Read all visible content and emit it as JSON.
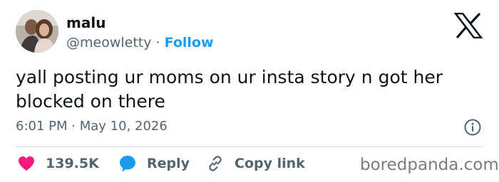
{
  "author": {
    "display_name": "malu",
    "handle": "@meowletty",
    "separator": "·",
    "follow_label": "Follow"
  },
  "tweet": {
    "text": "yall posting ur moms on ur insta story n got her blocked on there",
    "time": "6:01 PM",
    "date_separator": "·",
    "date": "May 10, 2026"
  },
  "actions": {
    "like_count": "139.5K",
    "reply_label": "Reply",
    "copy_link_label": "Copy link"
  },
  "watermark": "boredpanda.com",
  "icons": {
    "logo": "x-logo-icon",
    "info": "info-icon",
    "like": "heart-icon",
    "reply": "speech-bubble-icon",
    "copy": "link-icon"
  },
  "colors": {
    "text": "#0f1419",
    "secondary": "#536471",
    "accent": "#1d9bf0",
    "like": "#f91880",
    "divider": "#cfd9de",
    "watermark": "#7b7b7b"
  }
}
